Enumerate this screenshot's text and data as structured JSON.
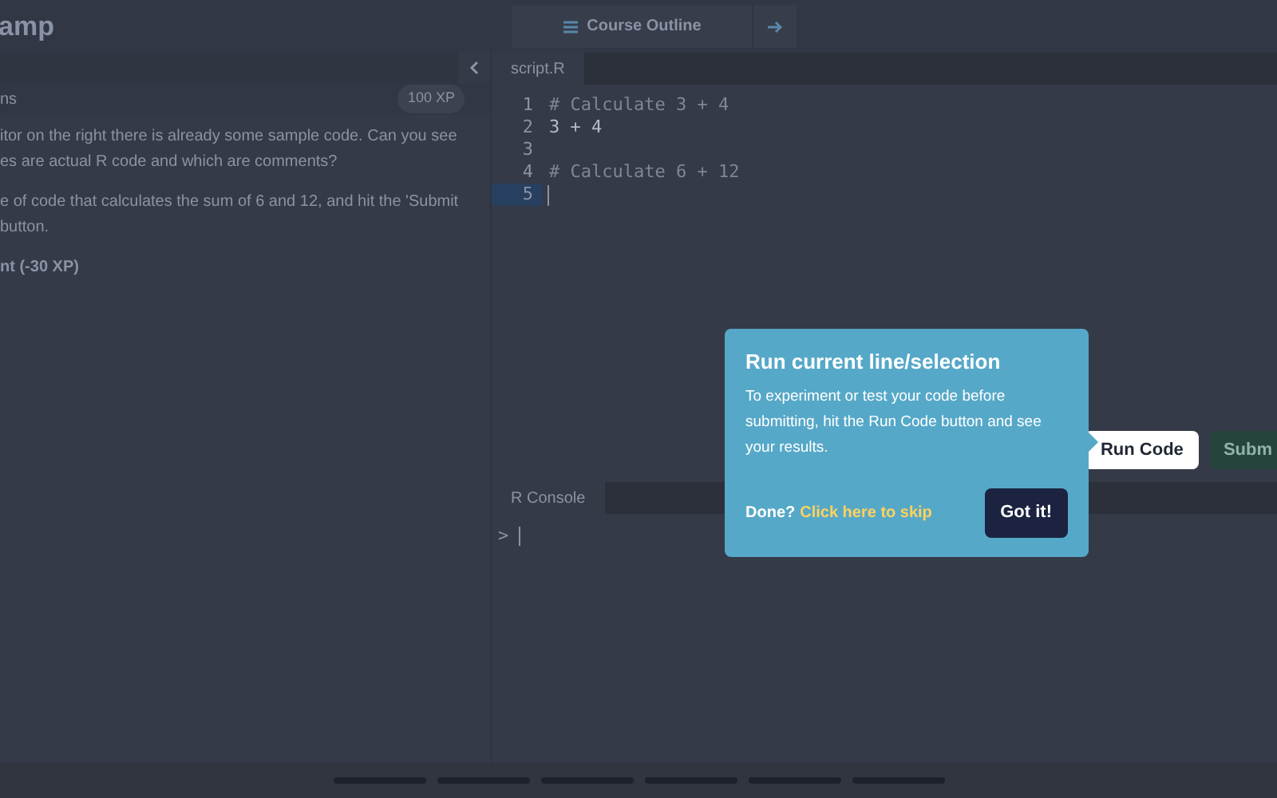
{
  "header": {
    "title": "amp",
    "course_outline": {
      "label": "Course Outline"
    }
  },
  "exercise": {
    "heading": "ns",
    "xp_badge": "100 XP",
    "paragraphs": [
      {
        "lines": [
          "itor on the right there is already some sample code. Can you see",
          "es are actual R code and which are comments?"
        ]
      },
      {
        "lines": [
          "e of code that calculates the sum of 6 and 12, and hit the 'Submit",
          "button."
        ]
      }
    ],
    "hint": "nt (-30 XP)"
  },
  "editor": {
    "tab": "script.R",
    "lines": [
      {
        "number": "1",
        "kind": "comment",
        "text": "# Calculate 3 + 4",
        "active": false
      },
      {
        "number": "2",
        "kind": "code",
        "text": "3 + 4",
        "active": false
      },
      {
        "number": "3",
        "kind": "blank",
        "active": false
      },
      {
        "number": "4",
        "kind": "comment",
        "text": "# Calculate 6 + 12",
        "active": false
      },
      {
        "number": "5",
        "kind": "blank",
        "active": true
      }
    ]
  },
  "actions": {
    "run": "Run Code",
    "submit": "Subm"
  },
  "console": {
    "tab": "R Console",
    "prompt": ">"
  },
  "tooltip": {
    "title": "Run current line/selection",
    "body": "To experiment or test your code before submitting, hit the Run Code button and see your results.",
    "done": "Done?",
    "skip_link": "Click here to skip",
    "got_it": "Got it!"
  }
}
